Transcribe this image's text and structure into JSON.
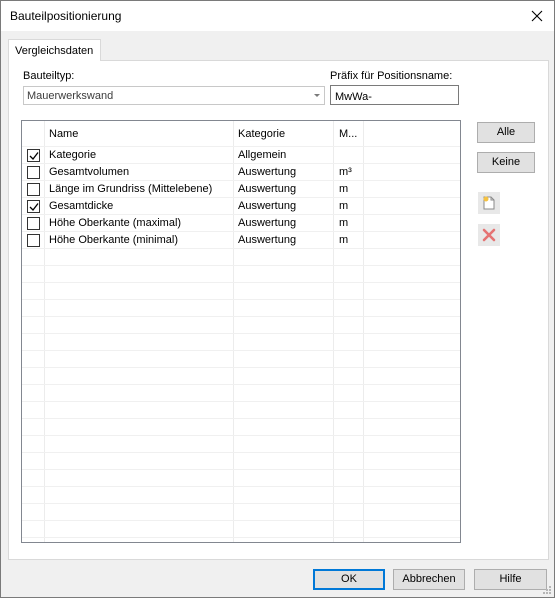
{
  "window": {
    "title": "Bauteilpositionierung"
  },
  "tabs": [
    {
      "label": "Vergleichsdaten"
    }
  ],
  "form": {
    "bauteiltyp_label": "Bauteiltyp:",
    "bauteiltyp_value": "Mauerwerkswand",
    "praefix_label": "Präfix für Positionsname:",
    "praefix_value": "MwWa-"
  },
  "grid": {
    "columns": [
      "Name",
      "Kategorie",
      "M..."
    ],
    "rows": [
      {
        "checked": true,
        "name": "Kategorie",
        "kategorie": "Allgemein",
        "m": ""
      },
      {
        "checked": false,
        "name": "Gesamtvolumen",
        "kategorie": "Auswertung",
        "m": "m³"
      },
      {
        "checked": false,
        "name": "Länge im Grundriss (Mittelebene)",
        "kategorie": "Auswertung",
        "m": "m"
      },
      {
        "checked": true,
        "name": "Gesamtdicke",
        "kategorie": "Auswertung",
        "m": "m"
      },
      {
        "checked": false,
        "name": "Höhe Oberkante (maximal)",
        "kategorie": "Auswertung",
        "m": "m"
      },
      {
        "checked": false,
        "name": "Höhe Oberkante (minimal)",
        "kategorie": "Auswertung",
        "m": "m"
      }
    ]
  },
  "side_buttons": {
    "alle": "Alle",
    "keine": "Keine"
  },
  "footer": {
    "ok": "OK",
    "abbrechen": "Abbrechen",
    "hilfe": "Hilfe"
  },
  "colors": {
    "accent": "#0078d7",
    "delete_icon": "#e57373"
  }
}
